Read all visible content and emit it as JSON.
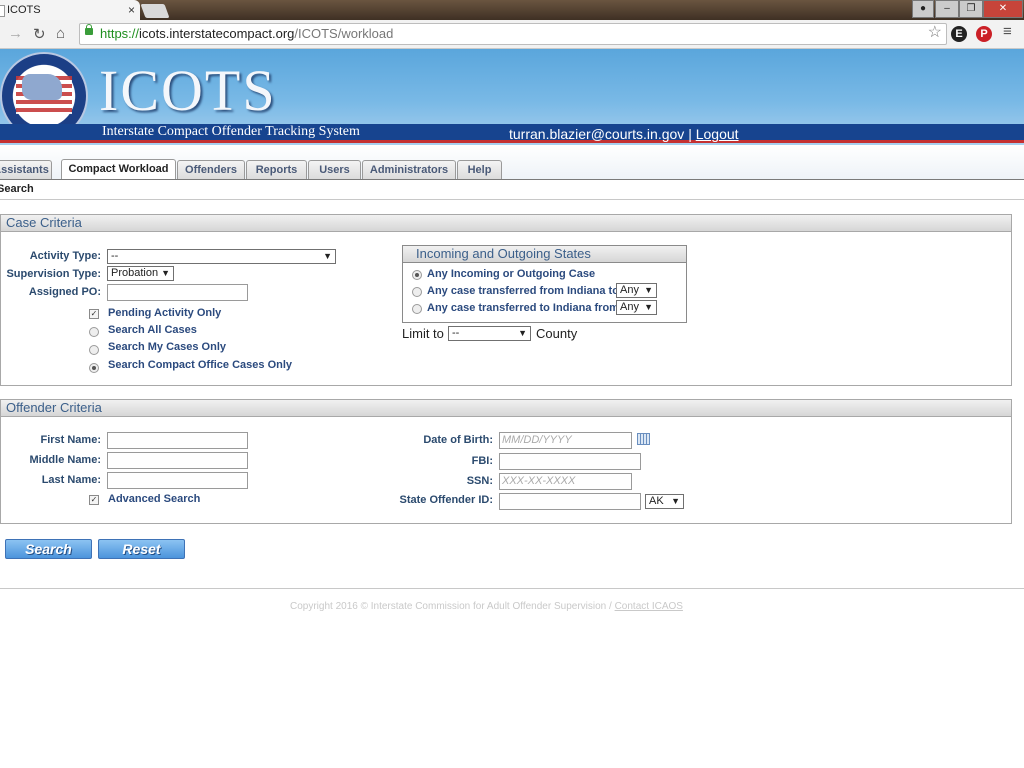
{
  "browser": {
    "tab_title": "ICOTS",
    "tab_close": "×",
    "url_prefix": "https://",
    "url_host": "icots.interstatecompact.org",
    "url_path": "/ICOTS/workload"
  },
  "header": {
    "logo": "ICOTS",
    "subtitle": "Interstate Compact Offender Tracking System",
    "user_email": "turran.blazier@courts.in.gov",
    "separator": "|",
    "logout": "Logout"
  },
  "nav": {
    "tabs": [
      "Assistants",
      "Compact Workload",
      "Offenders",
      "Reports",
      "Users",
      "Administrators",
      "Help"
    ],
    "active": "Compact Workload",
    "subnav": "Search"
  },
  "case_criteria": {
    "title": "Case Criteria",
    "activity_type_label": "Activity Type:",
    "activity_type_value": "--",
    "supervision_type_label": "Supervision Type:",
    "supervision_type_value": "Probation",
    "assigned_po_label": "Assigned PO:",
    "pending_only": "Pending Activity Only",
    "search_all": "Search All Cases",
    "search_my": "Search My Cases Only",
    "search_office": "Search Compact Office Cases Only",
    "states_box": {
      "title": "Incoming and Outgoing States",
      "any": "Any Incoming or Outgoing Case",
      "from": "Any case transferred from Indiana to",
      "from_value": "Any",
      "to": "Any case transferred to Indiana from",
      "to_value": "Any"
    },
    "limit_to": "Limit to",
    "county_value": "--",
    "county": "County"
  },
  "offender_criteria": {
    "title": "Offender Criteria",
    "first_name_label": "First Name:",
    "middle_name_label": "Middle Name:",
    "last_name_label": "Last Name:",
    "advanced_search": "Advanced Search",
    "dob_label": "Date of Birth:",
    "dob_placeholder": "MM/DD/YYYY",
    "fbi_label": "FBI:",
    "ssn_label": "SSN:",
    "ssn_placeholder": "XXX-XX-XXXX",
    "state_id_label": "State Offender ID:",
    "state_value": "AK"
  },
  "buttons": {
    "search": "Search",
    "reset": "Reset"
  },
  "footer": {
    "copyright": "Copyright 2016 © Interstate Commission for Adult Offender Supervision / ",
    "contact": "Contact ICAOS"
  }
}
